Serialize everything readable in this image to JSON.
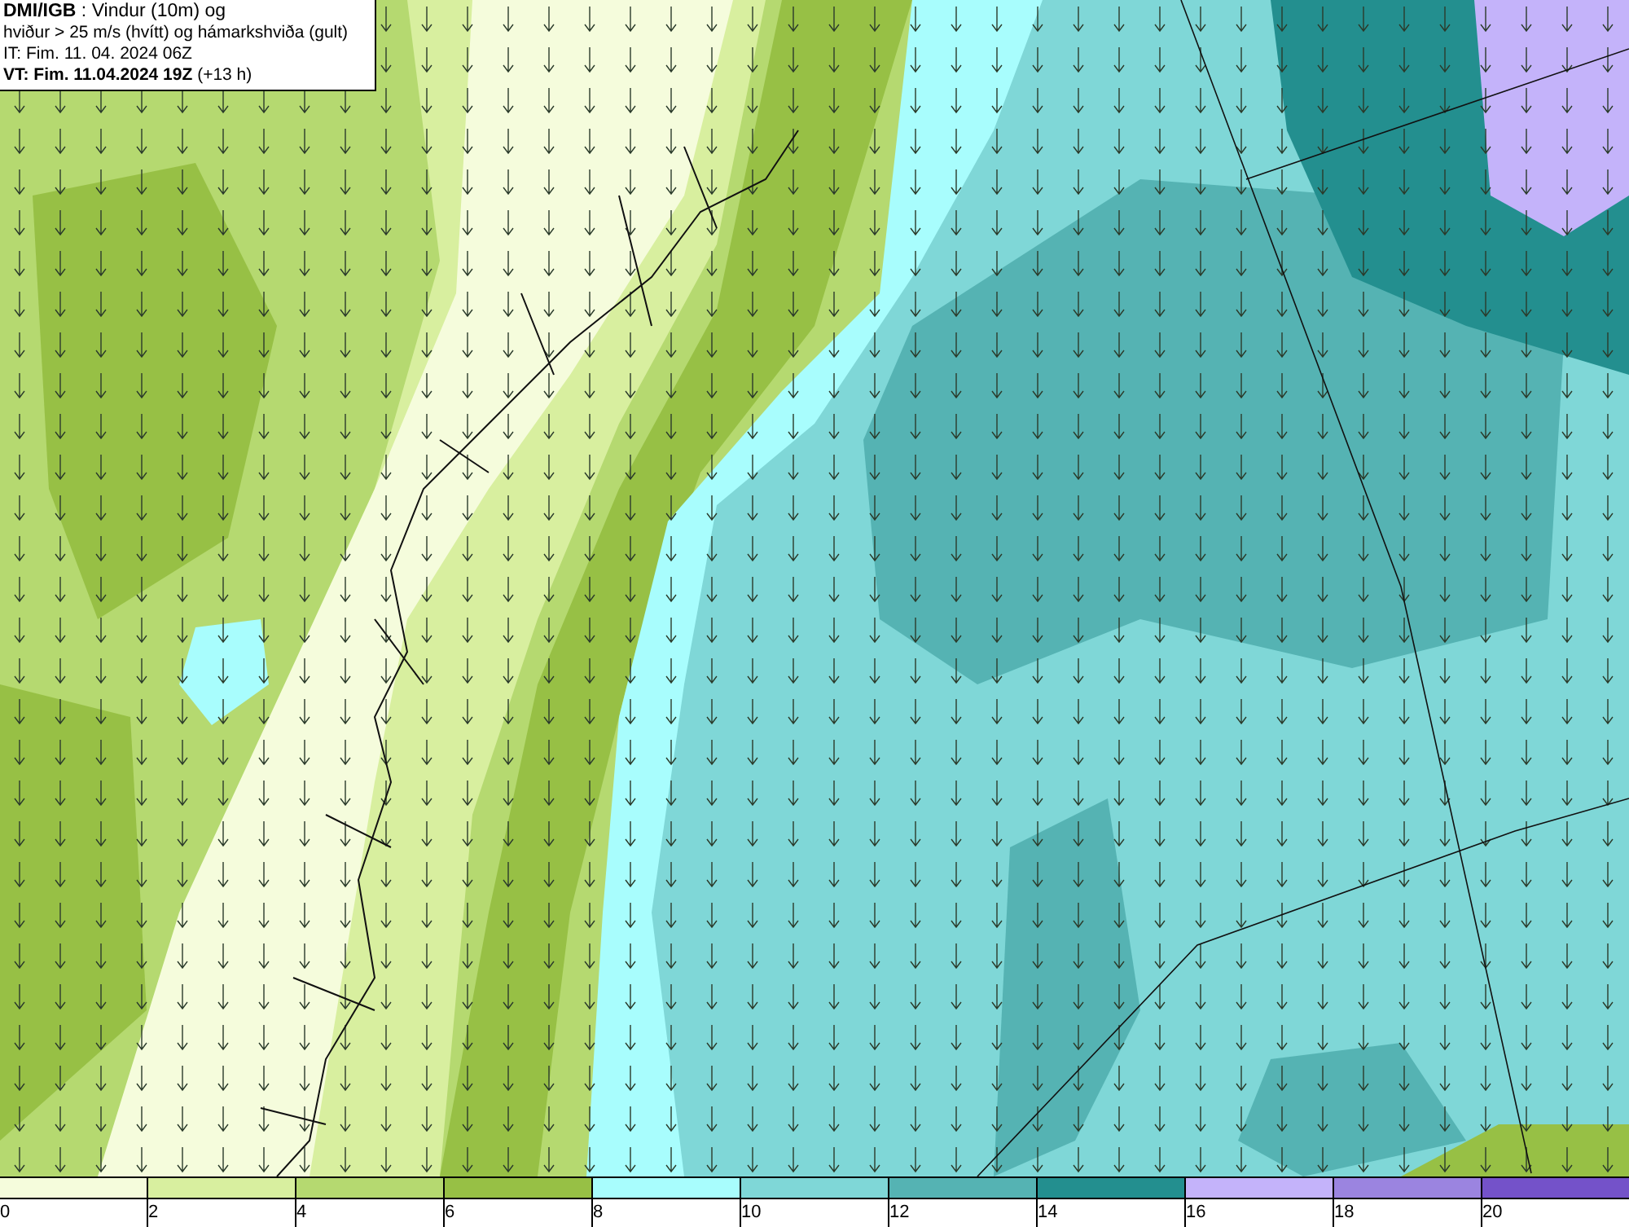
{
  "title_box": {
    "lines": [
      "**DMI/IGB** : Vindur (10m) og",
      "hviður > 25 m/s (hvítt) og hámarkshviða (gult)",
      "IT: Fim. 11. 04. 2024 06Z",
      "**VT: Fim. 11.04.2024 19Z** (+13 h)"
    ]
  },
  "legend": {
    "items": [
      {
        "label": "0",
        "color": "#f5fcdc"
      },
      {
        "label": "2",
        "color": "#d8ef9f"
      },
      {
        "label": "4",
        "color": "#b5d970"
      },
      {
        "label": "6",
        "color": "#97c045"
      },
      {
        "label": "8",
        "color": "#a8fdfd"
      },
      {
        "label": "10",
        "color": "#7fd7d7"
      },
      {
        "label": "12",
        "color": "#55b3b3"
      },
      {
        "label": "14",
        "color": "#238f8f"
      },
      {
        "label": "16",
        "color": "#c4b3fa"
      },
      {
        "label": "18",
        "color": "#9b84e0"
      },
      {
        "label": "20",
        "color": "#7452c9"
      }
    ]
  }
}
